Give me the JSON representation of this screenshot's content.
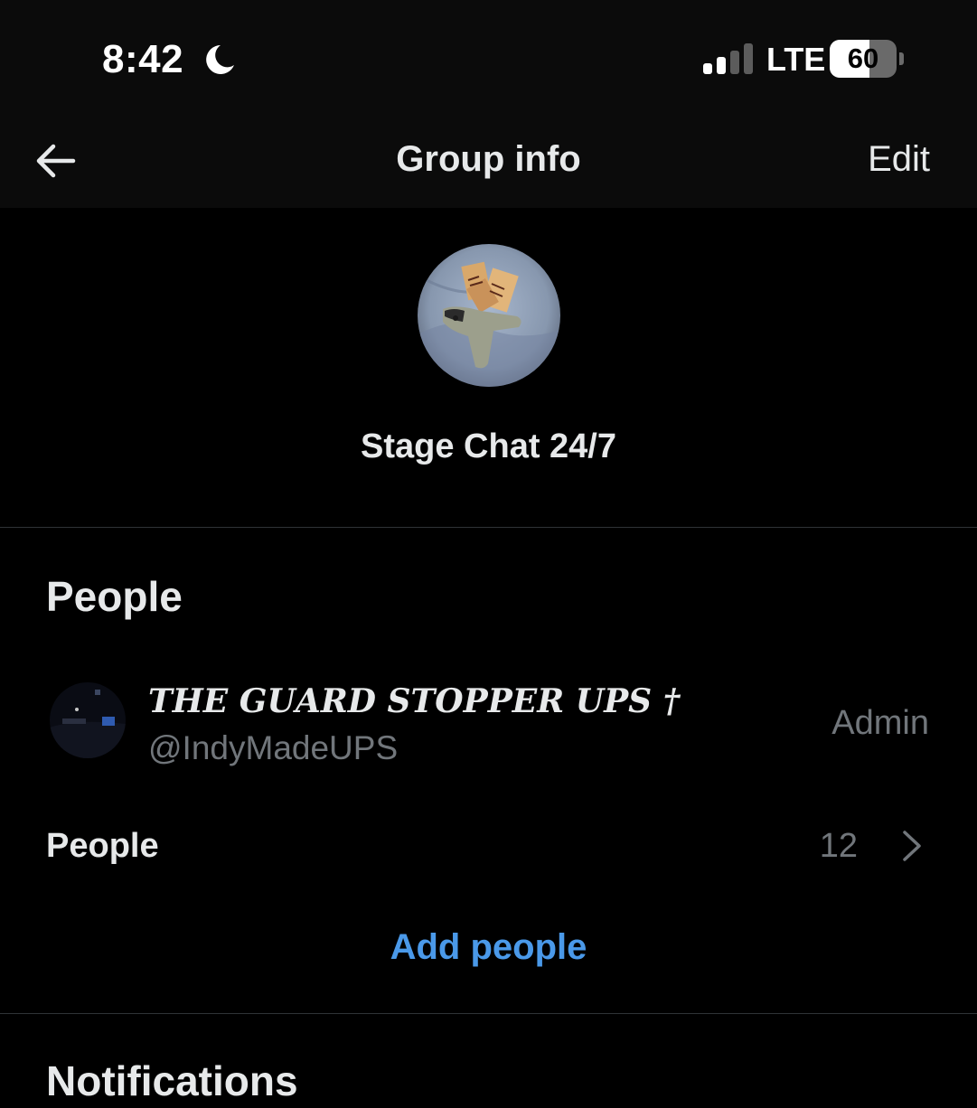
{
  "status_bar": {
    "time": "8:42",
    "moon_icon": "moon-icon",
    "signal_icon": "cellular-signal-icon",
    "network": "LTE",
    "battery_level": "60",
    "battery_fraction": 0.6
  },
  "header": {
    "back_icon": "arrow-left-icon",
    "title": "Group info",
    "edit_label": "Edit"
  },
  "group": {
    "name": "Stage Chat 24/7"
  },
  "people_section": {
    "heading": "People",
    "members": [
      {
        "name": "𝑻𝑯𝑬 𝑮𝑼𝑨𝑹𝑫 𝑺𝑻𝑶𝑷𝑷𝑬𝑹 𝑼𝑷𝑺 †",
        "handle": "@IndyMadeUPS",
        "role": "Admin"
      }
    ],
    "people_row": {
      "label": "People",
      "count": "12"
    },
    "add_people_label": "Add people"
  },
  "notifications_section": {
    "heading": "Notifications"
  },
  "colors": {
    "background": "#000000",
    "bar_background": "#0b0b0b",
    "primary_text": "#e7e9ea",
    "secondary_text": "#71767b",
    "accent": "#4a99e9",
    "divider": "#2f3336"
  }
}
